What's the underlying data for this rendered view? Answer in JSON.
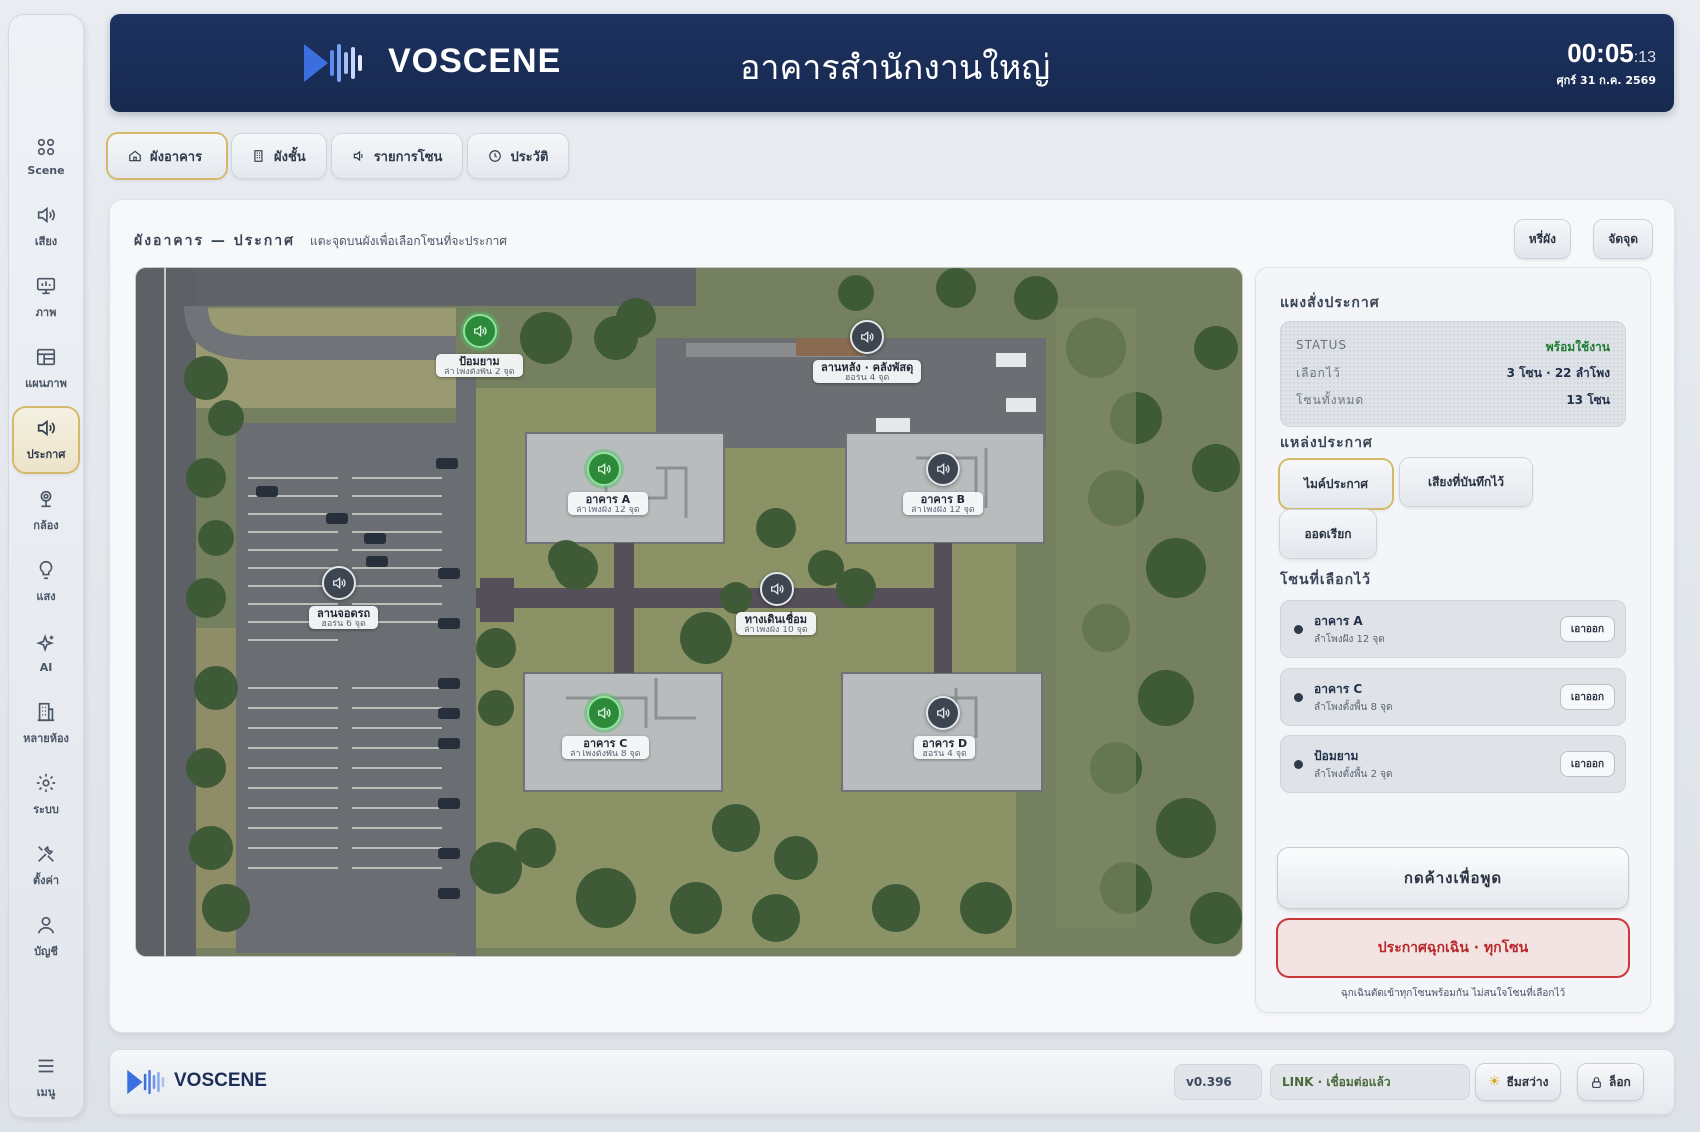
{
  "rail": {
    "items": [
      {
        "label": "Scene",
        "icon": "grid-icon"
      },
      {
        "label": "เสียง",
        "icon": "speaker-icon"
      },
      {
        "label": "ภาพ",
        "icon": "monitor-icon"
      },
      {
        "label": "แผนภาพ",
        "icon": "layout-icon"
      },
      {
        "label": "ประกาศ",
        "icon": "announce-icon",
        "active": true
      },
      {
        "label": "กล้อง",
        "icon": "camera-icon"
      },
      {
        "label": "แสง",
        "icon": "bulb-icon"
      },
      {
        "label": "AI",
        "icon": "sparkle-icon"
      },
      {
        "label": "หลายห้อง",
        "icon": "building-icon"
      },
      {
        "label": "ระบบ",
        "icon": "gear-icon"
      },
      {
        "label": "ตั้งค่า",
        "icon": "tools-icon"
      },
      {
        "label": "บัญชี",
        "icon": "user-icon"
      },
      {
        "label": "เมนู",
        "icon": "menu-icon"
      }
    ]
  },
  "header": {
    "brand": "VOSCENE",
    "title": "อาคารสำนักงานใหญ่",
    "time": "00:05",
    "seconds": ":13",
    "date": "ศุกร์ 31 ก.ค. 2569"
  },
  "tabs": [
    {
      "label": "ผังอาคาร",
      "icon": "home-icon",
      "active": true
    },
    {
      "label": "ผังชั้น",
      "icon": "floors-icon"
    },
    {
      "label": "รายการโซน",
      "icon": "speaker-icon"
    },
    {
      "label": "ประวัติ",
      "icon": "clock-icon"
    }
  ],
  "main": {
    "title": "ผังอาคาร — ประกาศ",
    "subtitle": "แตะจุดบนผังเพื่อเลือกโซนที่จะประกาศ",
    "zoom_out_label": "หรี่ผัง",
    "arrange_label": "จัดจุด"
  },
  "map": {
    "zones": [
      {
        "name": "ป้อมยาม",
        "count": "ลำโพงตั้งพื้น 2 จุด",
        "selected": true
      },
      {
        "name": "ลานหลัง · คลังพัสดุ",
        "count": "ฮอร์น 4 จุด",
        "selected": false
      },
      {
        "name": "อาคาร A",
        "count": "ลำโพงฝัง 12 จุด",
        "selected": true
      },
      {
        "name": "อาคาร B",
        "count": "ลำโพงฝัง 12 จุด",
        "selected": false
      },
      {
        "name": "ลานจอดรถ",
        "count": "ฮอร์น 6 จุด",
        "selected": false
      },
      {
        "name": "ทางเดินเชื่อม",
        "count": "ลำโพงฝัง 10 จุด",
        "selected": false
      },
      {
        "name": "อาคาร C",
        "count": "ลำโพงตั้งพื้น 8 จุด",
        "selected": true
      },
      {
        "name": "อาคาร D",
        "count": "ฮอร์น 4 จุด",
        "selected": false
      }
    ]
  },
  "panel": {
    "title": "แผงสั่งประกาศ",
    "status": {
      "status_key": "STATUS",
      "status_val": "พร้อมใช้งาน",
      "selected_key": "เลือกไว้",
      "selected_val": "3 โซน · 22 ลำโพง",
      "total_key": "โซนทั้งหมด",
      "total_val": "13 โซน"
    },
    "source_title": "แหล่งประกาศ",
    "sources": [
      "ไมค์ประกาศ",
      "เสียงที่บันทึกไว้",
      "ออดเรียก"
    ],
    "selected_title": "โซนที่เลือกไว้",
    "selected_zones": [
      {
        "name": "อาคาร A",
        "detail": "ลำโพงฝัง 12 จุด",
        "remove": "เอาออก"
      },
      {
        "name": "อาคาร C",
        "detail": "ลำโพงตั้งพื้น 8 จุด",
        "remove": "เอาออก"
      },
      {
        "name": "ป้อมยาม",
        "detail": "ลำโพงตั้งพื้น 2 จุด",
        "remove": "เอาออก"
      }
    ],
    "talk_label": "กดค้างเพื่อพูด",
    "emergency_label": "ประกาศฉุกเฉิน · ทุกโซน",
    "emergency_note": "ฉุกเฉินตัดเข้าทุกโซนพร้อมกัน ไม่สนใจโซนที่เลือกไว้"
  },
  "footer": {
    "brand": "VOSCENE",
    "version": "v0.396",
    "link": "LINK · เชื่อมต่อแล้ว",
    "theme_label": "ธีมสว่าง",
    "lock_label": "ล็อก"
  },
  "colors": {
    "header_bg": "#1d3260",
    "accent_gold": "#d6b86a",
    "selected_green": "#2c8a3a",
    "emergency_red": "#c9393a",
    "brand_blue": "#3b6fe0"
  }
}
